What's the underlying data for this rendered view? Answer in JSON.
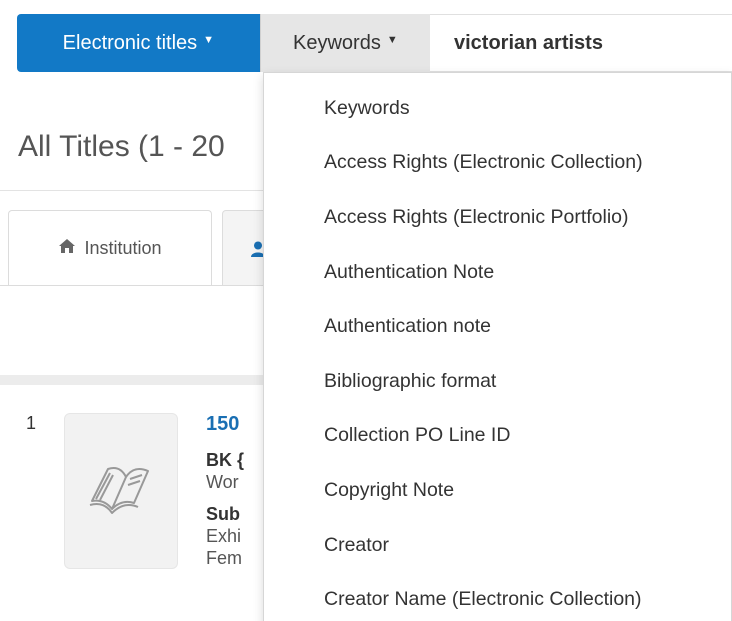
{
  "search": {
    "scope_label": "Electronic titles",
    "field_label": "Keywords",
    "query_value": "victorian artists",
    "scope_color": "#1279c6"
  },
  "page": {
    "title": "All Titles (1 - 20"
  },
  "tabs": {
    "institution_label": "Institution",
    "institution_icon": "home-icon",
    "second_icon": "user-icon"
  },
  "result": {
    "number": "1",
    "title": "150",
    "type": "BK {",
    "line1": "Wor",
    "subject_label": "Sub",
    "line2": "Exhi",
    "line3": "Fem",
    "icon": "open-book-icon"
  },
  "dropdown": {
    "items": [
      "Keywords",
      "Access Rights (Electronic Collection)",
      "Access Rights (Electronic Portfolio)",
      "Authentication Note",
      "Authentication note",
      "Bibliographic format",
      "Collection PO Line ID",
      "Copyright Note",
      "Creator",
      "Creator Name (Electronic Collection)"
    ]
  }
}
